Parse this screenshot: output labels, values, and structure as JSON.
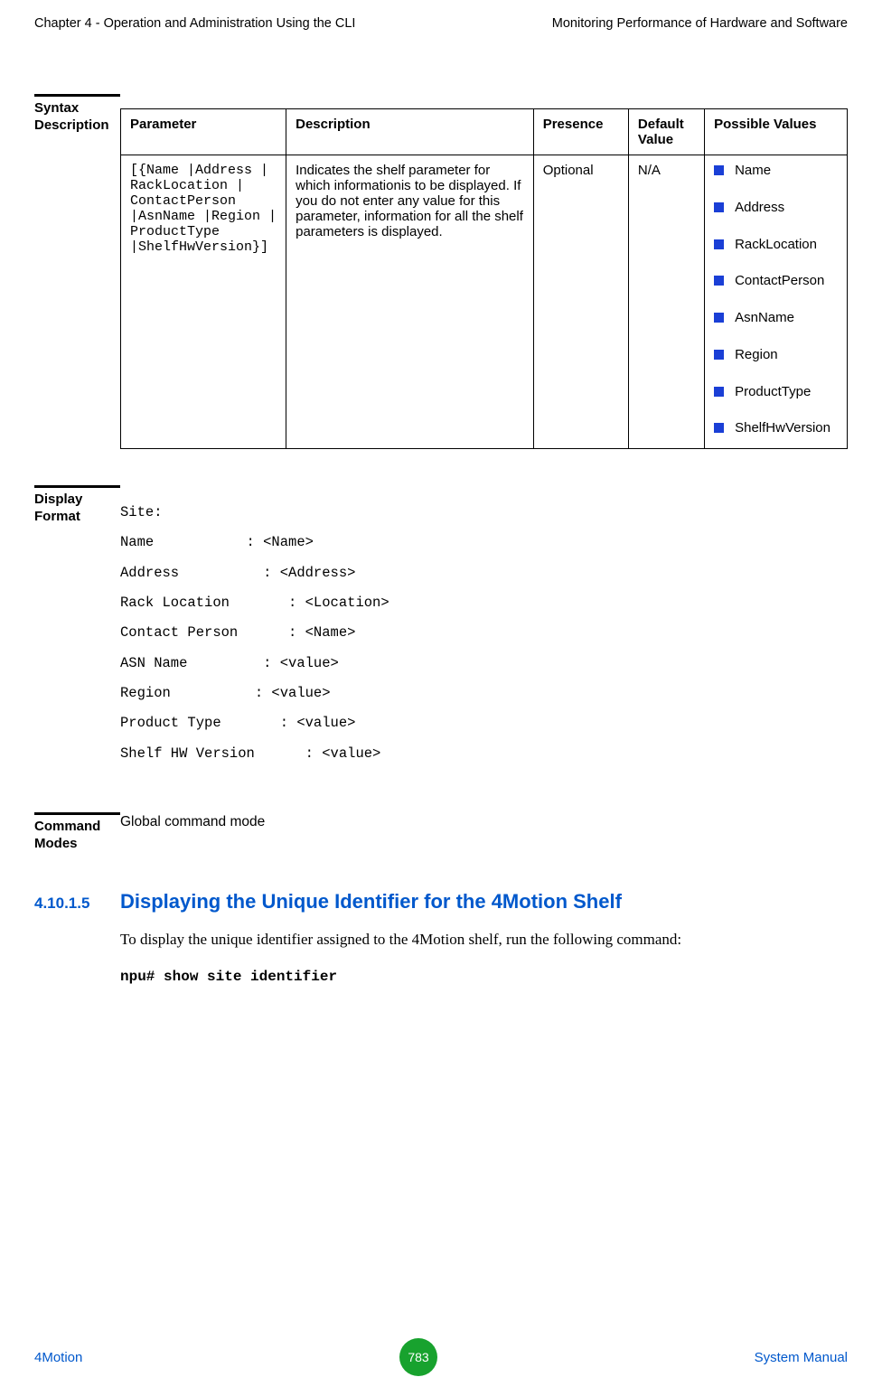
{
  "header": {
    "left": "Chapter 4 - Operation and Administration Using the CLI",
    "right": "Monitoring Performance of Hardware and Software"
  },
  "syntax": {
    "label": "Syntax Description",
    "columns": {
      "parameter": "Parameter",
      "description": "Description",
      "presence": "Presence",
      "default": "Default Value",
      "values": "Possible Values"
    },
    "row": {
      "parameter": "[{Name |Address | RackLocation | ContactPerson |AsnName |Region | ProductType |ShelfHwVersion}]",
      "description": "Indicates the shelf parameter for which informationis to be displayed. If you do not enter any value for this parameter, information for all the shelf parameters is displayed.",
      "presence": "Optional",
      "default": "N/A",
      "values": [
        "Name",
        "Address",
        "RackLocation",
        "ContactPerson",
        "AsnName",
        "Region",
        "ProductType",
        "ShelfHwVersion"
      ]
    }
  },
  "display": {
    "label": "Display Format",
    "lines": "Site:\nName           : <Name>\nAddress          : <Address>\nRack Location       : <Location>\nContact Person      : <Name>\nASN Name         : <value>\nRegion          : <value>\nProduct Type       : <value>\nShelf HW Version      : <value>"
  },
  "command_modes": {
    "label": "Command Modes",
    "text": "Global command mode"
  },
  "subsection": {
    "number": "4.10.1.5",
    "title": "Displaying the Unique Identifier for the 4Motion Shelf",
    "para": "To display the unique identifier assigned to the 4Motion shelf, run the following command:",
    "command": "npu# show site identifier"
  },
  "footer": {
    "left": "4Motion",
    "page": "783",
    "right": "System Manual"
  }
}
